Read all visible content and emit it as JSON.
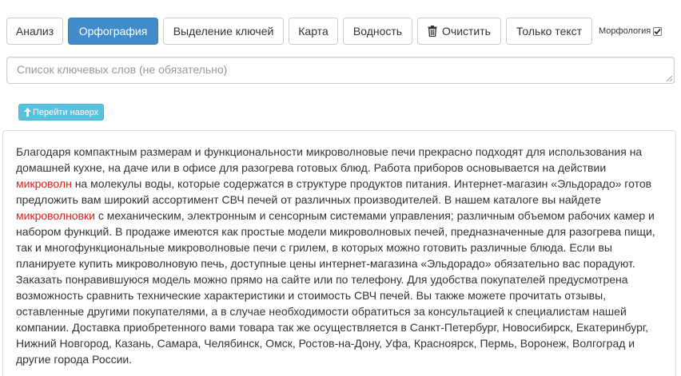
{
  "toolbar": {
    "buttons": [
      {
        "label": "Анализ"
      },
      {
        "label": "Орфография"
      },
      {
        "label": "Выделение ключей"
      },
      {
        "label": "Карта"
      },
      {
        "label": "Водность"
      },
      {
        "label": "Очистить",
        "icon": "trash-icon"
      },
      {
        "label": "Только текст"
      }
    ],
    "morphology_label": "Морфология",
    "morphology_checked": true,
    "active_button": "Орфография"
  },
  "keywords_field": {
    "placeholder": "Список ключевых слов (не обязательно)",
    "value": ""
  },
  "scroll_top_button": {
    "label": "Перейти наверх",
    "icon": "arrow-up-icon"
  },
  "content": {
    "segments": [
      {
        "text": "Благодаря компактным размерам и функциональности микроволновые печи прекрасно подходят для использования на домашней кухне, на даче или в офисе для разогрева готовых блюд. Работа приборов основывается на действии ",
        "error": false
      },
      {
        "text": "микроволн",
        "error": true
      },
      {
        "text": " на молекулы воды, которые содержатся в структуре продуктов питания. Интернет-магазин «Эльдорадо» готов предложить вам широкий ассортимент СВЧ печей от различных производителей. В нашем каталоге вы найдете ",
        "error": false
      },
      {
        "text": "микроволновки",
        "error": true
      },
      {
        "text": " с механическим, электронным и сенсорным системами управления; различным объемом рабочих камер и набором функций. В продаже имеются как простые модели микроволновых печей, предназначенные для разогрева пищи, так и многофункциональные микроволновые печи с грилем, в которых можно готовить различные блюда. Если вы планируете купить микроволновую печь, доступные цены интернет-магазина «Эльдорадо» обязательно вас порадуют. Заказать понравившуюся модель можно прямо на сайте или по телефону. Для удобства покупателей предусмотрена возможность сравнить технические характеристики и стоимость СВЧ печей. Вы также можете прочитать отзывы, оставленные другими покупателями, а в случае необходимости обратиться за консультацией к специалистам нашей компании. Доставка приобретенного вами товара так же осуществляется в Санкт-Петербург, Новосибирск, Екатеринбург, Нижний Новгород, Казань, Самара, Челябинск, Омск, Ростов-на-Дону, Уфа, Красноярск, Пермь, Воронеж, Волгоград и другие города России.",
        "error": false
      }
    ]
  },
  "colors": {
    "primary": "#428bca",
    "info": "#5bc0de",
    "error_text": "#d9221c",
    "text": "#333333"
  }
}
